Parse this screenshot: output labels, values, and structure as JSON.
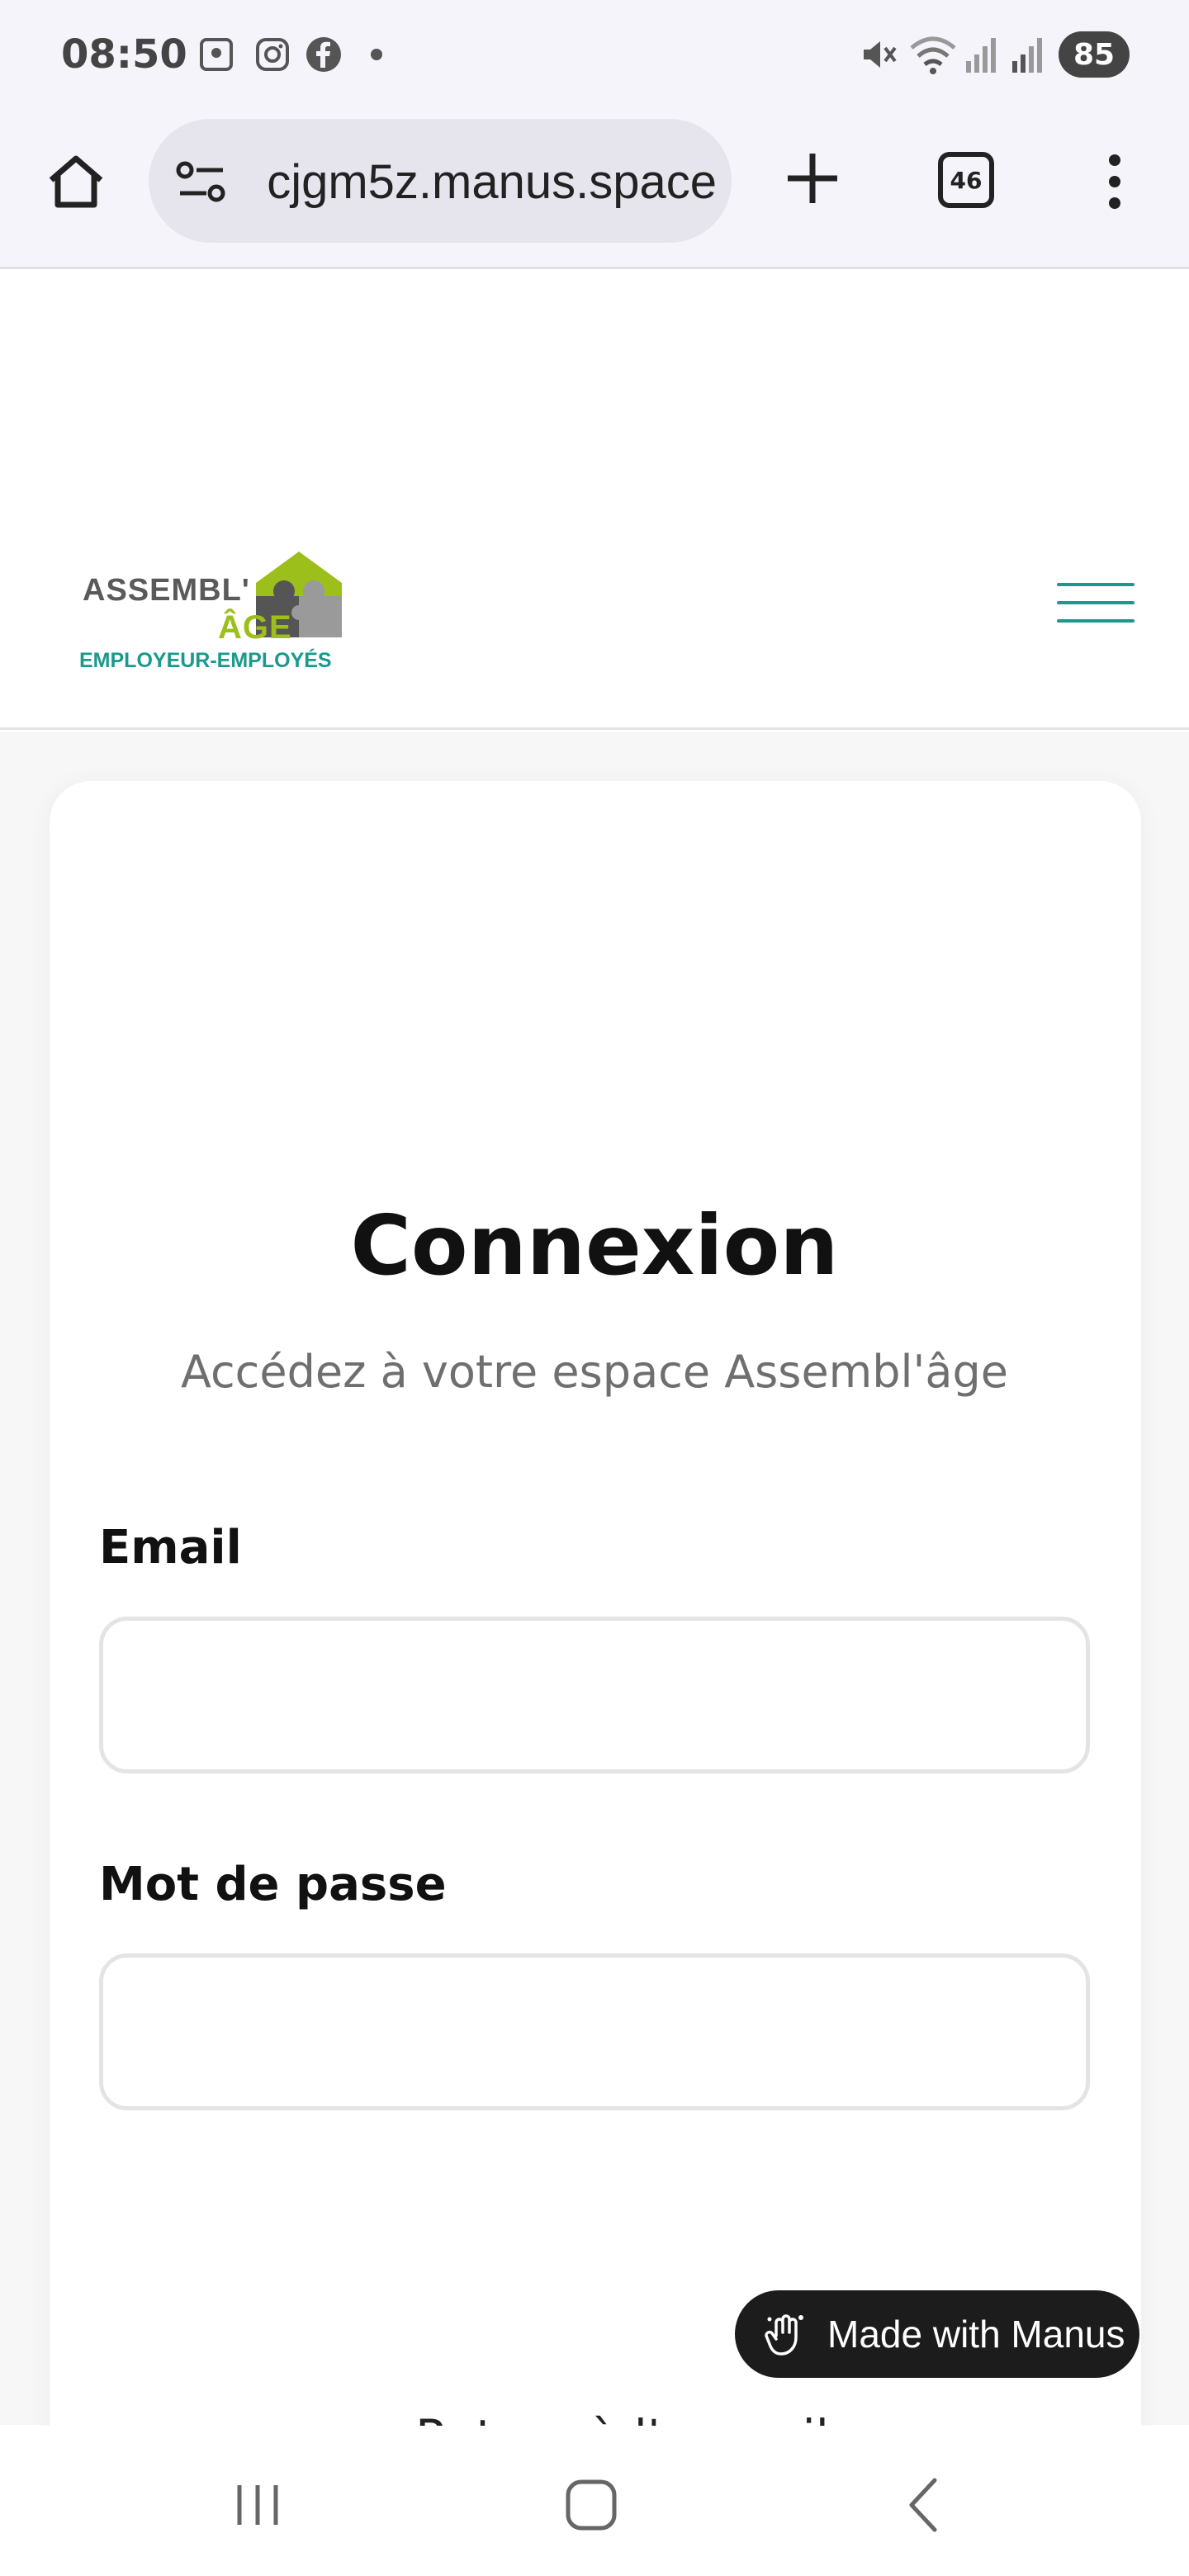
{
  "status_bar": {
    "time": "08:50",
    "battery": "85",
    "icons": [
      "screenshot-icon",
      "instagram-icon",
      "facebook-icon",
      "dot-icon",
      "mute-icon",
      "wifi-icon",
      "signal-icon",
      "signal-icon"
    ]
  },
  "browser": {
    "url": "cjgm5z.manus.space",
    "tab_count": "46"
  },
  "site": {
    "logo_line1": "ASSEMBL'",
    "logo_line2": "ÂGE",
    "logo_line3": "EMPLOYEUR-EMPLOYÉS",
    "brand_colors": {
      "green": "#9cbf1c",
      "teal": "#1a9a8c",
      "grey": "#5a5a5a"
    }
  },
  "login": {
    "title": "Connexion",
    "subtitle": "Accédez à votre espace Assembl'âge",
    "email_label": "Email",
    "email_value": "",
    "password_label": "Mot de passe",
    "password_value": "",
    "back_link": "← Retour à l'accueil"
  },
  "badge": {
    "label": "Made with Manus"
  }
}
